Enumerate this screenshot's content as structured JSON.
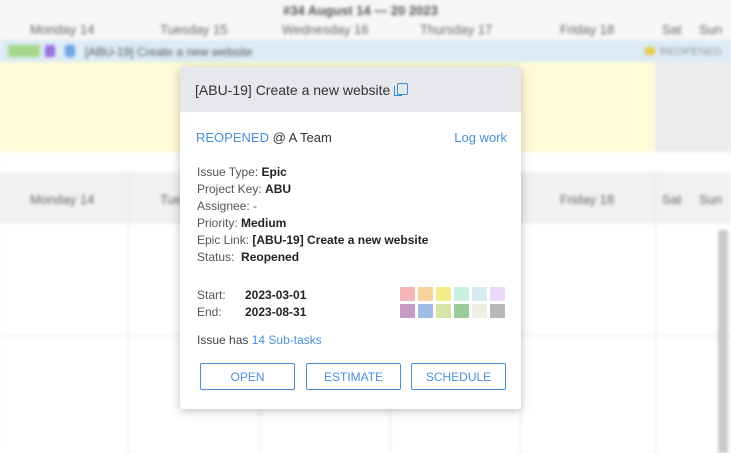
{
  "calendar": {
    "week_title": "#34 August 14 — 20 2023",
    "days_top": [
      "Monday 14",
      "Tuesday 15",
      "Wednesday 16",
      "Thursday 17",
      "Friday 18",
      "Sat",
      "Sun"
    ],
    "days_bottom": [
      "Monday 14",
      "Tue",
      "Friday 18",
      "Sat",
      "Sun"
    ],
    "task_row_text": "[ABU-19] Create a new website",
    "task_row_status": "REOPENED"
  },
  "popup": {
    "title": "[ABU-19] Create a new website",
    "status": "REOPENED",
    "team": "@ A Team",
    "log_work": "Log work",
    "fields": [
      {
        "label": "Issue Type:",
        "value": "Epic"
      },
      {
        "label": "Project Key:",
        "value": "ABU"
      },
      {
        "label": "Assignee:",
        "value": "-"
      },
      {
        "label": "Priority:",
        "value": "Medium"
      },
      {
        "label": "Epic Link:",
        "value": "[ABU-19] Create a new website"
      },
      {
        "label": "Status:",
        "value": "Reopened"
      }
    ],
    "start_label": "Start:",
    "start_value": "2023-03-01",
    "end_label": "End:",
    "end_value": "2023-08-31",
    "subtasks_prefix": "Issue has",
    "subtasks_link": "14 Sub-tasks",
    "buttons": [
      "OPEN",
      "ESTIMATE",
      "SCHEDULE"
    ],
    "swatch_colors": [
      "#f4b6b6",
      "#f6d29c",
      "#f2ec8a",
      "#c9f0de",
      "#d9ecf2",
      "#ead9f6",
      "#c79cc4",
      "#9fbde6",
      "#d6e4a8",
      "#9acb9a",
      "#efefe6",
      "#b9b9b9"
    ]
  }
}
